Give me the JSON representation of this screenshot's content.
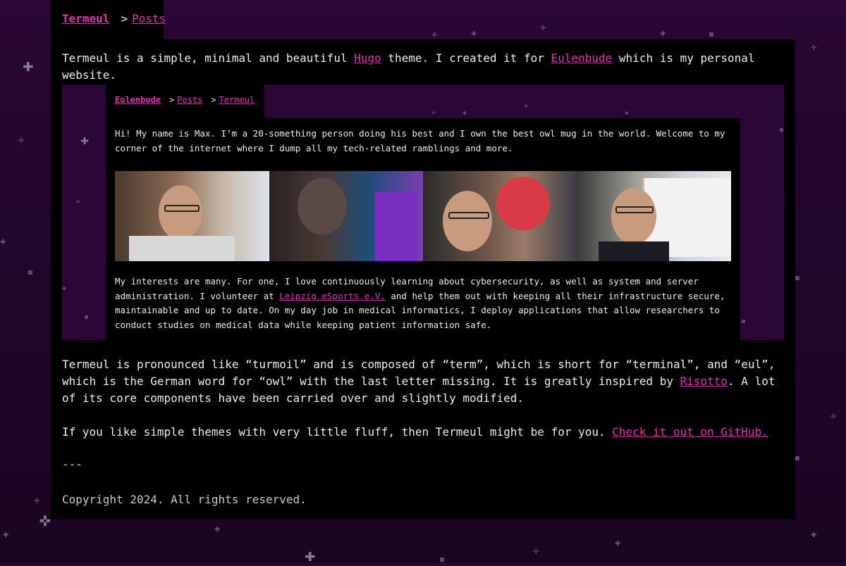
{
  "header": {
    "home_label": "Termeul",
    "separator": ">",
    "posts_label": "Posts"
  },
  "intro": {
    "before_hugo": "Termeul is a simple, minimal and beautiful ",
    "hugo_link": "Hugo",
    "middle": " theme. I created it for ",
    "eulenbude_link": "Eulenbude",
    "after": " which is my personal website."
  },
  "embedded_screenshot": {
    "breadcrumb": {
      "home_label": "Eulenbude",
      "separator": ">",
      "posts_label": "Posts",
      "current_label": "Termeul"
    },
    "intro_text": "Hi! My name is Max. I’m a 20-something person doing his best and I own the best owl mug in the world. Welcome to my corner of the internet where I dump all my tech-related ramblings and more.",
    "photos": [
      "photo-1",
      "photo-2",
      "photo-3",
      "photo-4"
    ],
    "interests_before": "My interests are many. For one, I love continuously learning about cybersecurity, as well as system and server administration. I volunteer at ",
    "interests_link": "Leipzig eSports e.V.",
    "interests_after": " and help them out with keeping all their infrastructure secure, maintainable and up to date. On my day job in medical informatics, I deploy applications that allow researchers to conduct studies on medical data while keeping patient information safe."
  },
  "pronunciation": {
    "before": "Termeul is pronounced like “turmoil” and is composed of “term”, which is short for “terminal”, and “eul”, which is the German word for “owl” with the last letter missing. It is greatly inspired by ",
    "risotto_link": "Risotto",
    "after": ". A lot of its core components have been carried over and slightly modified."
  },
  "cta": {
    "before": "If you like simple themes with very little fluff, then Termeul might be for you. ",
    "github_link": "Check it out on GitHub."
  },
  "divider": "---",
  "footer": {
    "copyright": "Copyright 2024. All rights reserved."
  },
  "colors": {
    "accent": "#e62fb4",
    "background": "#22062b",
    "panel": "#000000"
  }
}
